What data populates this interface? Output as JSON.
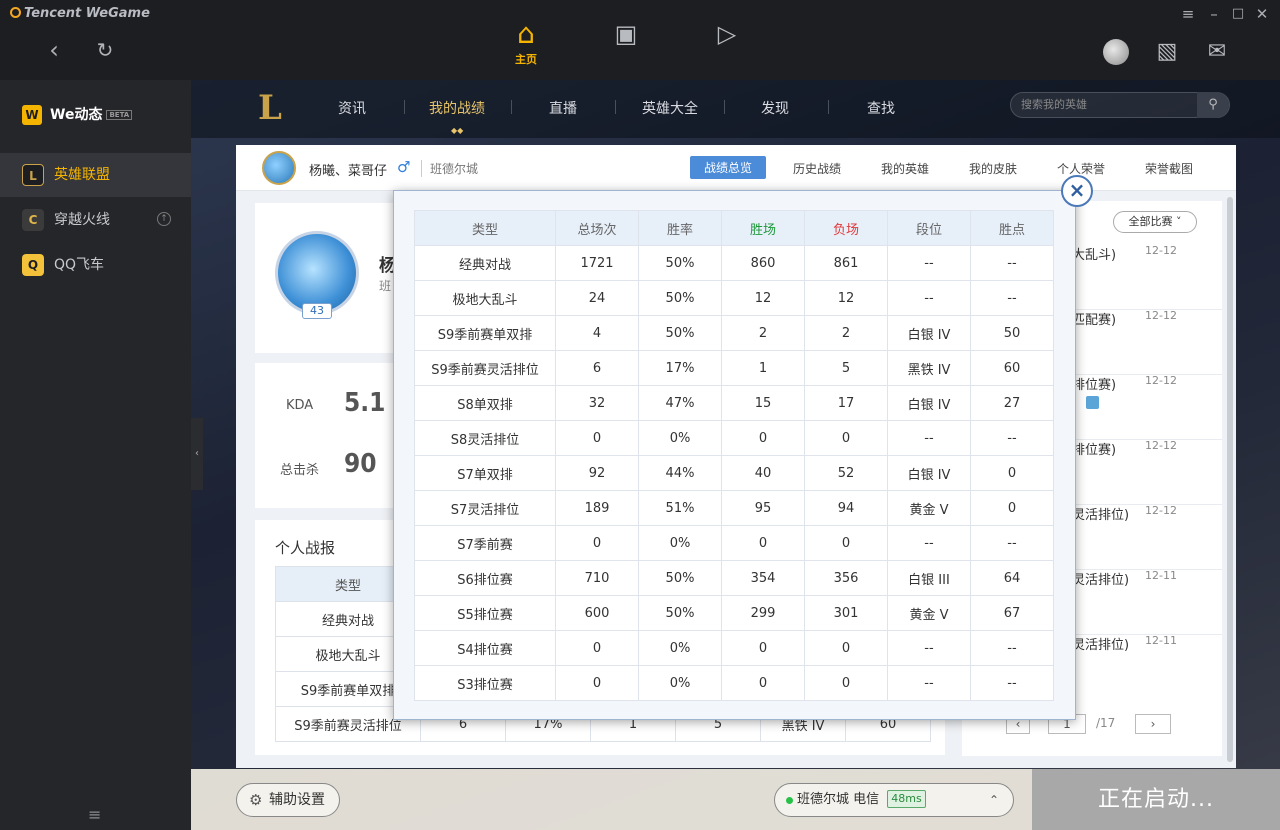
{
  "app": {
    "brand": "Tencent WeGame"
  },
  "topnav": {
    "home_label": "主页"
  },
  "sidebar": {
    "header": "We动态",
    "beta": "BETA",
    "items": [
      {
        "label": "英雄联盟",
        "active": true
      },
      {
        "label": "穿越火线",
        "active": false
      },
      {
        "label": "QQ飞车",
        "active": false
      }
    ]
  },
  "lol": {
    "tabs": [
      "资讯",
      "我的战绩",
      "直播",
      "英雄大全",
      "发现",
      "查找"
    ],
    "active_tab": "我的战绩",
    "search_placeholder": "搜索我的英雄"
  },
  "profile": {
    "name": "杨曦、菜哥仔",
    "server": "班德尔城",
    "tabs": [
      "战绩总览",
      "历史战绩",
      "我的英雄",
      "我的皮肤",
      "个人荣誉",
      "荣誉截图"
    ],
    "level": "43",
    "name_partial": "杨",
    "server_partial": "班"
  },
  "stats_left": {
    "kda_label": "KDA",
    "kda_value": "5.1",
    "kills_label": "总击杀",
    "kills_value": "90",
    "report_title": "个人战报",
    "table_header": "类型",
    "table_rows": [
      {
        "type": "经典对战",
        "a": "",
        "b": "",
        "c": "",
        "d": "",
        "e": "",
        "f": ""
      },
      {
        "type": "极地大乱斗",
        "a": "",
        "b": "",
        "c": "",
        "d": "",
        "e": "",
        "f": ""
      },
      {
        "type": "S9季前赛单双排",
        "a": "",
        "b": "",
        "c": "",
        "d": "",
        "e": "",
        "f": ""
      },
      {
        "type": "S9季前赛灵活排位",
        "a": "6",
        "b": "17%",
        "c": "1",
        "d": "5",
        "e": "黑铁 IV",
        "f": "60"
      }
    ]
  },
  "recent": {
    "filter": "全部比赛",
    "items": [
      {
        "text": "大乱斗)",
        "date": "12-12"
      },
      {
        "text": "匹配赛)",
        "date": "12-12"
      },
      {
        "text": "排位赛)",
        "date": "12-12"
      },
      {
        "text": "排位赛)",
        "date": "12-12"
      },
      {
        "text": "灵活排位)",
        "date": "12-12"
      },
      {
        "text": "灵活排位)",
        "date": "12-11"
      },
      {
        "text": "灵活排位)",
        "date": "12-11"
      }
    ],
    "page_current": "1",
    "page_total": "/17",
    "prev": "‹",
    "next": "›"
  },
  "popup": {
    "close": "×",
    "headers": [
      "类型",
      "总场次",
      "胜率",
      "胜场",
      "负场",
      "段位",
      "胜点"
    ],
    "rows": [
      [
        "经典对战",
        "1721",
        "50%",
        "860",
        "861",
        "--",
        "--"
      ],
      [
        "极地大乱斗",
        "24",
        "50%",
        "12",
        "12",
        "--",
        "--"
      ],
      [
        "S9季前赛单双排",
        "4",
        "50%",
        "2",
        "2",
        "白银 IV",
        "50"
      ],
      [
        "S9季前赛灵活排位",
        "6",
        "17%",
        "1",
        "5",
        "黑铁 IV",
        "60"
      ],
      [
        "S8单双排",
        "32",
        "47%",
        "15",
        "17",
        "白银 IV",
        "27"
      ],
      [
        "S8灵活排位",
        "0",
        "0%",
        "0",
        "0",
        "--",
        "--"
      ],
      [
        "S7单双排",
        "92",
        "44%",
        "40",
        "52",
        "白银 IV",
        "0"
      ],
      [
        "S7灵活排位",
        "189",
        "51%",
        "95",
        "94",
        "黄金 V",
        "0"
      ],
      [
        "S7季前赛",
        "0",
        "0%",
        "0",
        "0",
        "--",
        "--"
      ],
      [
        "S6排位赛",
        "710",
        "50%",
        "354",
        "356",
        "白银 III",
        "64"
      ],
      [
        "S5排位赛",
        "600",
        "50%",
        "299",
        "301",
        "黄金 V",
        "67"
      ],
      [
        "S4排位赛",
        "0",
        "0%",
        "0",
        "0",
        "--",
        "--"
      ],
      [
        "S3排位赛",
        "0",
        "0%",
        "0",
        "0",
        "--",
        "--"
      ]
    ]
  },
  "bottom": {
    "assist": "辅助设置",
    "server": "班德尔城 电信",
    "ping": "48ms",
    "launch": "正在启动..."
  },
  "colors": {
    "accent": "#f5b400",
    "win": "#1e9a3c",
    "loss": "#e03a3a",
    "tab_active": "#4b8bd8"
  }
}
